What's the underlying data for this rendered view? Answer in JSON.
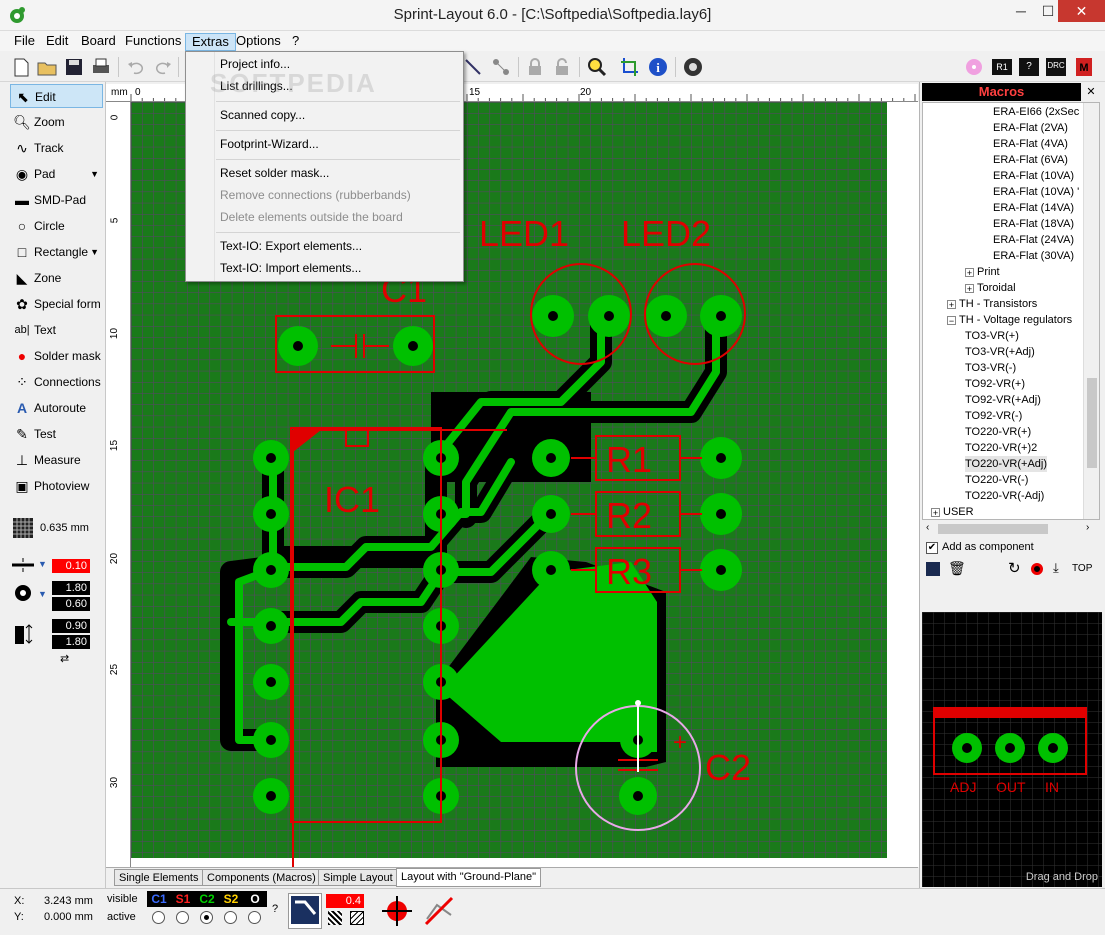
{
  "window": {
    "title": "Sprint-Layout 6.0 - [C:\\Softpedia\\Softpedia.lay6]",
    "minimize": "─",
    "maximize": "☐",
    "close": "✕"
  },
  "menubar": {
    "items": [
      "File",
      "Edit",
      "Board",
      "Functions",
      "Extras",
      "Options",
      "?"
    ],
    "open_item": "Extras"
  },
  "extras_menu": {
    "items": [
      {
        "label": "Project info...",
        "enabled": true
      },
      {
        "label": "List drillings...",
        "enabled": true
      },
      {
        "label": "Scanned copy...",
        "enabled": true
      },
      {
        "label": "Footprint-Wizard...",
        "enabled": true
      },
      {
        "label": "Reset solder mask...",
        "enabled": true
      },
      {
        "label": "Remove connections (rubberbands)",
        "enabled": false
      },
      {
        "label": "Delete elements outside the board",
        "enabled": false
      },
      {
        "label": "Text-IO: Export elements...",
        "enabled": true
      },
      {
        "label": "Text-IO: Import elements...",
        "enabled": true
      }
    ]
  },
  "tools": {
    "items": [
      {
        "label": "Edit",
        "icon": "cursor-icon"
      },
      {
        "label": "Zoom",
        "icon": "magnifier-icon"
      },
      {
        "label": "Track",
        "icon": "track-icon"
      },
      {
        "label": "Pad",
        "icon": "pad-icon"
      },
      {
        "label": "SMD-Pad",
        "icon": "smd-pad-icon"
      },
      {
        "label": "Circle",
        "icon": "circle-icon"
      },
      {
        "label": "Rectangle",
        "icon": "rectangle-icon"
      },
      {
        "label": "Zone",
        "icon": "zone-icon"
      },
      {
        "label": "Special form",
        "icon": "special-form-icon"
      },
      {
        "label": "Text",
        "icon": "text-icon"
      },
      {
        "label": "Solder mask",
        "icon": "solder-mask-icon"
      },
      {
        "label": "Connections",
        "icon": "connections-icon"
      },
      {
        "label": "Autoroute",
        "icon": "autoroute-icon"
      },
      {
        "label": "Test",
        "icon": "test-icon"
      },
      {
        "label": "Measure",
        "icon": "measure-icon"
      },
      {
        "label": "Photoview",
        "icon": "camera-icon"
      }
    ],
    "grid": "0.635 mm",
    "track_width": "0.10",
    "pad_outer": "1.80",
    "pad_inner": "0.60",
    "smd_width": "0.90",
    "smd_height": "1.80"
  },
  "rulers": {
    "unit": "mm",
    "top_labels": [
      "0",
      "15",
      "20"
    ],
    "left_labels": [
      "0",
      "5",
      "10",
      "15",
      "20",
      "25",
      "30"
    ]
  },
  "board": {
    "labels": [
      "LED1",
      "LED2",
      "C1",
      "IC1",
      "R1",
      "R2",
      "R3",
      "C2",
      "+"
    ],
    "watermark": "SOFTPEDIA"
  },
  "tabs": {
    "items": [
      "Single Elements",
      "Components (Macros)",
      "Simple Layout",
      "Layout with \"Ground-Plane\""
    ],
    "active": 3
  },
  "status": {
    "x_label": "X:",
    "x_value": "3.243 mm",
    "y_label": "Y:",
    "y_value": "0.000 mm",
    "visible_label": "visible",
    "active_label": "active",
    "layers": [
      "C1",
      "S1",
      "C2",
      "S2",
      "O"
    ],
    "layer_colors": [
      "#3b6bff",
      "#ff2020",
      "#00d000",
      "#ffd000",
      "#ffffff"
    ],
    "active_layer_index": 2,
    "help": "?",
    "ground_value": "0.4"
  },
  "macros": {
    "title": "Macros",
    "tree": [
      {
        "label": "ERA-EI66 (2xSec",
        "level": 3
      },
      {
        "label": "ERA-Flat (2VA)",
        "level": 3
      },
      {
        "label": "ERA-Flat (4VA)",
        "level": 3
      },
      {
        "label": "ERA-Flat (6VA)",
        "level": 3
      },
      {
        "label": "ERA-Flat (10VA)",
        "level": 3
      },
      {
        "label": "ERA-Flat (10VA) '",
        "level": 3
      },
      {
        "label": "ERA-Flat (14VA)",
        "level": 3
      },
      {
        "label": "ERA-Flat (18VA)",
        "level": 3
      },
      {
        "label": "ERA-Flat (24VA)",
        "level": 3
      },
      {
        "label": "ERA-Flat (30VA)",
        "level": 3
      },
      {
        "label": "Print",
        "level": 2,
        "toggle": "+"
      },
      {
        "label": "Toroidal",
        "level": 2,
        "toggle": "+"
      },
      {
        "label": "TH - Transistors",
        "level": 1,
        "toggle": "+"
      },
      {
        "label": "TH - Voltage regulators",
        "level": 1,
        "toggle": "−"
      },
      {
        "label": "TO3-VR(+)",
        "level": 2
      },
      {
        "label": "TO3-VR(+Adj)",
        "level": 2
      },
      {
        "label": "TO3-VR(-)",
        "level": 2
      },
      {
        "label": "TO92-VR(+)",
        "level": 2
      },
      {
        "label": "TO92-VR(+Adj)",
        "level": 2
      },
      {
        "label": "TO92-VR(-)",
        "level": 2
      },
      {
        "label": "TO220-VR(+)",
        "level": 2
      },
      {
        "label": "TO220-VR(+)2",
        "level": 2
      },
      {
        "label": "TO220-VR(+Adj)",
        "level": 2,
        "selected": true
      },
      {
        "label": "TO220-VR(-)",
        "level": 2
      },
      {
        "label": "TO220-VR(-Adj)",
        "level": 2
      },
      {
        "label": "USER",
        "level": 0,
        "toggle": "+"
      }
    ],
    "add_as_component": "Add as component",
    "top_label": "TOP",
    "preview_labels": [
      "ADJ",
      "OUT",
      "IN"
    ],
    "drag_and_drop": "Drag and Drop"
  }
}
